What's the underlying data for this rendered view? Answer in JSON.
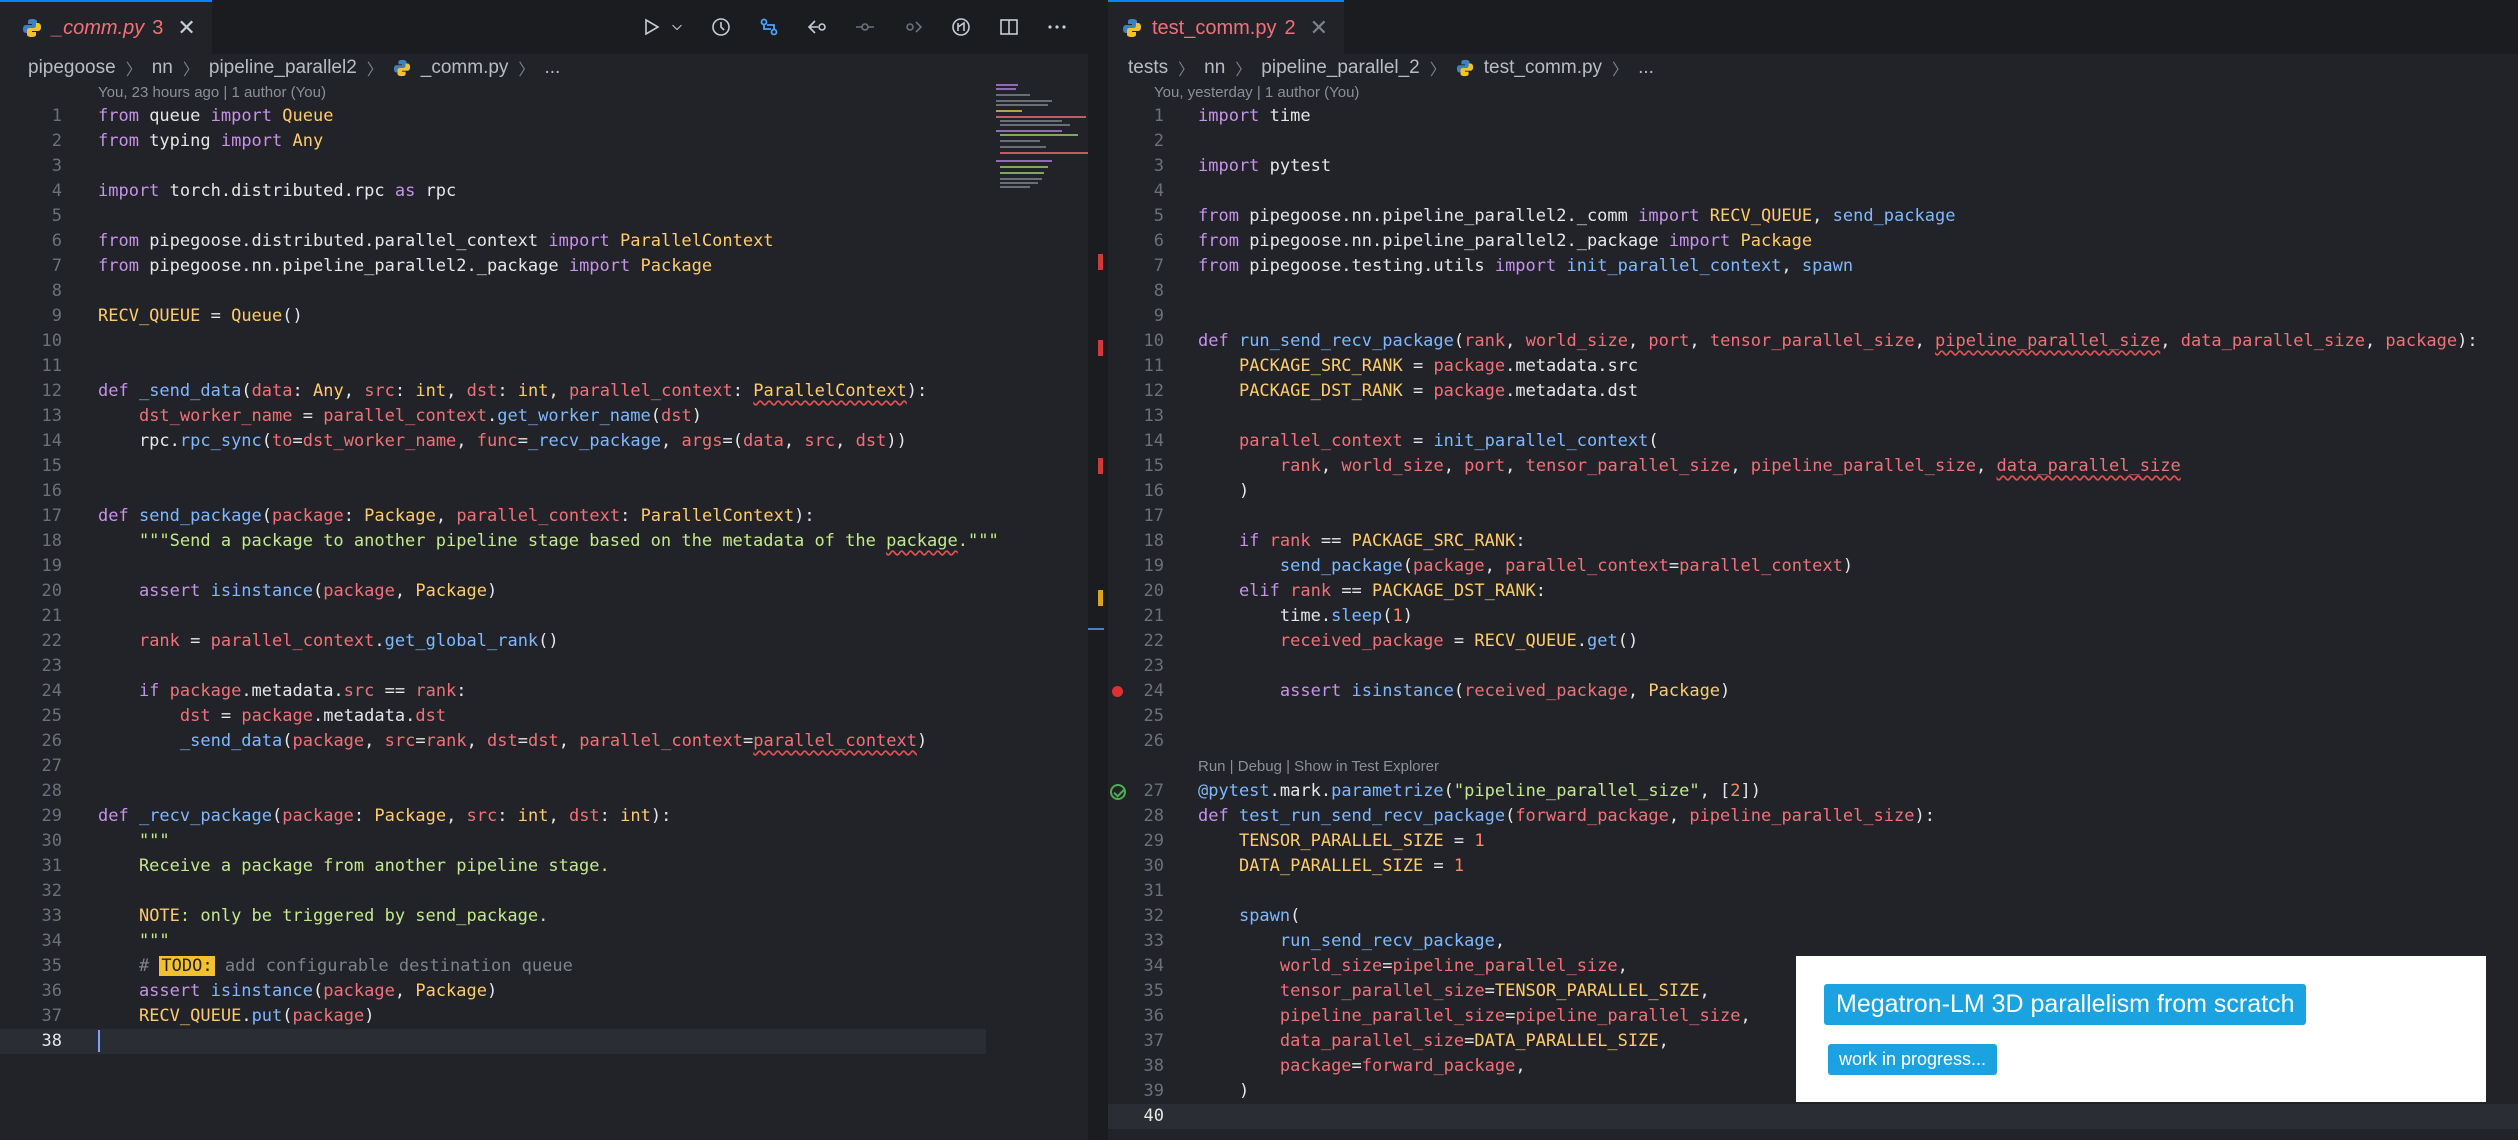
{
  "left": {
    "tab": {
      "name": "_comm.py",
      "count": "3"
    },
    "breadcrumb": [
      "pipegoose",
      "nn",
      "pipeline_parallel2",
      "_comm.py",
      "..."
    ],
    "blame": "You, 23 hours ago | 1 author (You)",
    "active_line": 38
  },
  "right": {
    "tab": {
      "name": "test_comm.py",
      "count": "2"
    },
    "breadcrumb": [
      "tests",
      "nn",
      "pipeline_parallel_2",
      "test_comm.py",
      "..."
    ],
    "blame": "You, yesterday | 1 author (You)",
    "codelens": "Run | Debug | Show in Test Explorer",
    "active_line": 40
  },
  "overlay": {
    "title": "Megatron-LM 3D parallelism from scratch",
    "subtitle": "work in progress..."
  },
  "icons": [
    "python-file-icon",
    "close-icon",
    "run-icon",
    "chevron-down-icon",
    "timeline-icon",
    "git-compare-icon",
    "go-back-icon",
    "previous-change-icon",
    "next-change-icon",
    "copilot-icon",
    "split-editor-icon",
    "more-actions-icon",
    "breakpoint-icon",
    "test-passed-icon"
  ],
  "colors": {
    "accent": "#0a84ff",
    "error": "#f07178",
    "badge": "#1aa3e0"
  }
}
